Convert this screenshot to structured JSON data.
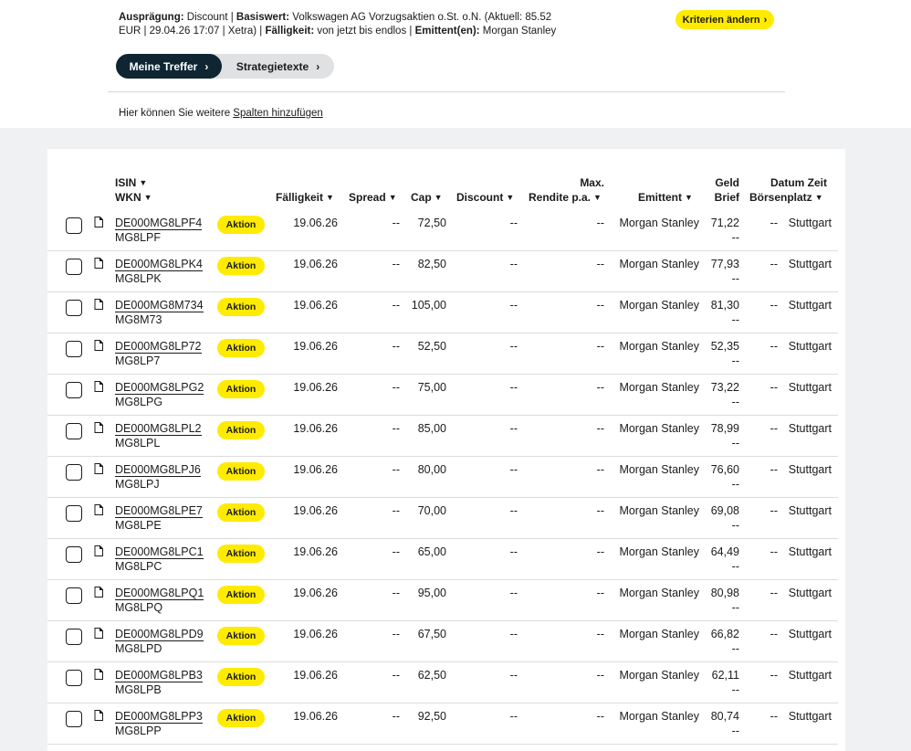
{
  "criteria": {
    "auspraegung_label": "Ausprägung:",
    "auspraegung_value": "Discount",
    "basiswert_label": "Basiswert:",
    "basiswert_value": "Volkswagen AG Vorzugsaktien o.St. o.N. (Aktuell: 85.52 EUR | 29.04.26 17:07 | Xetra)",
    "faelligkeit_label": "Fälligkeit:",
    "faelligkeit_value": "von jetzt bis endlos",
    "emittent_label": "Emittent(en):",
    "emittent_value": "Morgan Stanley",
    "separator": "|"
  },
  "buttons": {
    "change_criteria": "Kriterien ändern",
    "my_hits": "Meine Treffer",
    "strategy_texts": "Strategietexte"
  },
  "add_columns": {
    "prefix": "Hier können Sie weitere",
    "link": "Spalten hinzufügen"
  },
  "table": {
    "headers": {
      "isin": "ISIN",
      "wkn": "WKN",
      "faelligkeit": "Fälligkeit",
      "spread": "Spread",
      "cap": "Cap",
      "discount": "Discount",
      "max": "Max.",
      "rendite": "Rendite p.a.",
      "emittent": "Emittent",
      "geld": "Geld",
      "brief": "Brief",
      "datum_zeit": "Datum Zeit",
      "boersenplatz": "Börsenplatz"
    },
    "badge_label": "Aktion",
    "rows": [
      {
        "isin": "DE000MG8LPF4",
        "wkn": "MG8LPF",
        "faelligkeit": "19.06.26",
        "spread": "--",
        "cap": "72,50",
        "discount": "--",
        "rendite": "--",
        "emittent": "Morgan Stanley",
        "geld": "71,22",
        "brief": "--",
        "datum": "--",
        "boerse": "Stuttgart"
      },
      {
        "isin": "DE000MG8LPK4",
        "wkn": "MG8LPK",
        "faelligkeit": "19.06.26",
        "spread": "--",
        "cap": "82,50",
        "discount": "--",
        "rendite": "--",
        "emittent": "Morgan Stanley",
        "geld": "77,93",
        "brief": "--",
        "datum": "--",
        "boerse": "Stuttgart"
      },
      {
        "isin": "DE000MG8M734",
        "wkn": "MG8M73",
        "faelligkeit": "19.06.26",
        "spread": "--",
        "cap": "105,00",
        "discount": "--",
        "rendite": "--",
        "emittent": "Morgan Stanley",
        "geld": "81,30",
        "brief": "--",
        "datum": "--",
        "boerse": "Stuttgart"
      },
      {
        "isin": "DE000MG8LP72",
        "wkn": "MG8LP7",
        "faelligkeit": "19.06.26",
        "spread": "--",
        "cap": "52,50",
        "discount": "--",
        "rendite": "--",
        "emittent": "Morgan Stanley",
        "geld": "52,35",
        "brief": "--",
        "datum": "--",
        "boerse": "Stuttgart"
      },
      {
        "isin": "DE000MG8LPG2",
        "wkn": "MG8LPG",
        "faelligkeit": "19.06.26",
        "spread": "--",
        "cap": "75,00",
        "discount": "--",
        "rendite": "--",
        "emittent": "Morgan Stanley",
        "geld": "73,22",
        "brief": "--",
        "datum": "--",
        "boerse": "Stuttgart"
      },
      {
        "isin": "DE000MG8LPL2",
        "wkn": "MG8LPL",
        "faelligkeit": "19.06.26",
        "spread": "--",
        "cap": "85,00",
        "discount": "--",
        "rendite": "--",
        "emittent": "Morgan Stanley",
        "geld": "78,99",
        "brief": "--",
        "datum": "--",
        "boerse": "Stuttgart"
      },
      {
        "isin": "DE000MG8LPJ6",
        "wkn": "MG8LPJ",
        "faelligkeit": "19.06.26",
        "spread": "--",
        "cap": "80,00",
        "discount": "--",
        "rendite": "--",
        "emittent": "Morgan Stanley",
        "geld": "76,60",
        "brief": "--",
        "datum": "--",
        "boerse": "Stuttgart"
      },
      {
        "isin": "DE000MG8LPE7",
        "wkn": "MG8LPE",
        "faelligkeit": "19.06.26",
        "spread": "--",
        "cap": "70,00",
        "discount": "--",
        "rendite": "--",
        "emittent": "Morgan Stanley",
        "geld": "69,08",
        "brief": "--",
        "datum": "--",
        "boerse": "Stuttgart"
      },
      {
        "isin": "DE000MG8LPC1",
        "wkn": "MG8LPC",
        "faelligkeit": "19.06.26",
        "spread": "--",
        "cap": "65,00",
        "discount": "--",
        "rendite": "--",
        "emittent": "Morgan Stanley",
        "geld": "64,49",
        "brief": "--",
        "datum": "--",
        "boerse": "Stuttgart"
      },
      {
        "isin": "DE000MG8LPQ1",
        "wkn": "MG8LPQ",
        "faelligkeit": "19.06.26",
        "spread": "--",
        "cap": "95,00",
        "discount": "--",
        "rendite": "--",
        "emittent": "Morgan Stanley",
        "geld": "80,98",
        "brief": "--",
        "datum": "--",
        "boerse": "Stuttgart"
      },
      {
        "isin": "DE000MG8LPD9",
        "wkn": "MG8LPD",
        "faelligkeit": "19.06.26",
        "spread": "--",
        "cap": "67,50",
        "discount": "--",
        "rendite": "--",
        "emittent": "Morgan Stanley",
        "geld": "66,82",
        "brief": "--",
        "datum": "--",
        "boerse": "Stuttgart"
      },
      {
        "isin": "DE000MG8LPB3",
        "wkn": "MG8LPB",
        "faelligkeit": "19.06.26",
        "spread": "--",
        "cap": "62,50",
        "discount": "--",
        "rendite": "--",
        "emittent": "Morgan Stanley",
        "geld": "62,11",
        "brief": "--",
        "datum": "--",
        "boerse": "Stuttgart"
      },
      {
        "isin": "DE000MG8LPP3",
        "wkn": "MG8LPP",
        "faelligkeit": "19.06.26",
        "spread": "--",
        "cap": "92,50",
        "discount": "--",
        "rendite": "--",
        "emittent": "Morgan Stanley",
        "geld": "80,74",
        "brief": "--",
        "datum": "--",
        "boerse": "Stuttgart"
      }
    ]
  },
  "colors": {
    "accent_yellow": "#ffeb00",
    "dark_navy": "#0f2532",
    "page_gray": "#f0f1f2"
  }
}
